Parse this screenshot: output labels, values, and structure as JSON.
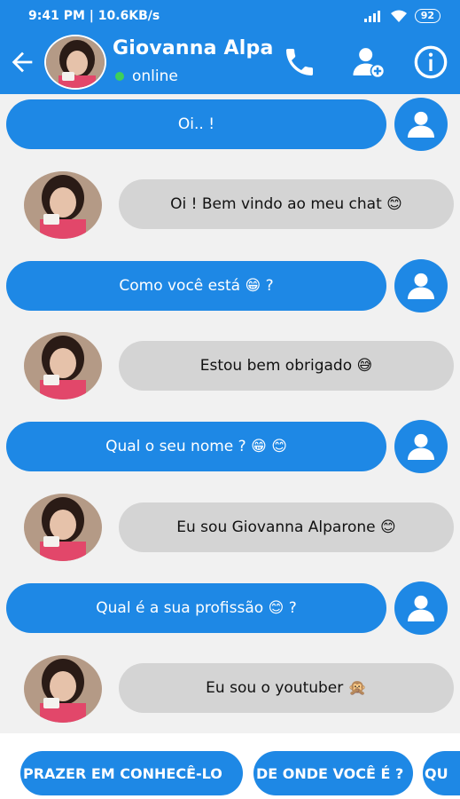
{
  "status": {
    "time_speed": "9:41 PM | 10.6KB/s",
    "battery": "92"
  },
  "header": {
    "name": "Giovanna Alpa",
    "presence": "online"
  },
  "messages": [
    {
      "text": "Oi.. !"
    },
    {
      "text": "Oi ! Bem vindo ao meu chat 😊"
    },
    {
      "text": "Como você está 😁 ?"
    },
    {
      "text": "Estou bem obrigado 😅"
    },
    {
      "text": "Qual o seu nome ? 😁 😊"
    },
    {
      "text": "Eu sou Giovanna Alparone 😊"
    },
    {
      "text": "Qual é a sua profissão 😊 ?"
    },
    {
      "text": "Eu sou o youtuber 🙊"
    }
  ],
  "quick_replies": [
    {
      "label": "PRAZER EM CONHECÊ-LO"
    },
    {
      "label": "DE ONDE VOCÊ É ?"
    },
    {
      "label": "QU"
    }
  ]
}
